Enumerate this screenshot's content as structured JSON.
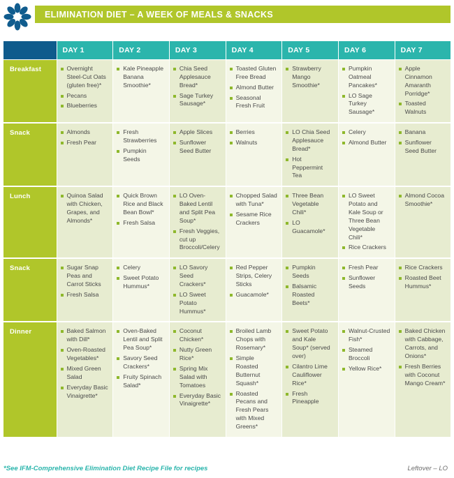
{
  "header": {
    "logo_icon": "flower-asterisk-logo",
    "title": "ELIMINATION DIET – A WEEK OF MEALS & SNACKS",
    "title_bar_color": "#b0c62a",
    "logo_color": "#105c8e"
  },
  "table": {
    "corner_label": "",
    "day_columns": [
      "DAY 1",
      "DAY 2",
      "DAY 3",
      "DAY 4",
      "DAY 5",
      "DAY 6",
      "DAY 7"
    ],
    "row_labels": [
      "Breakfast",
      "Snack",
      "Lunch",
      "Snack",
      "Dinner"
    ],
    "colors": {
      "header_corner": "#0f5b8c",
      "day_header": "#2bb5ac",
      "row_label": "#b0c62a",
      "cell_odd": "#e7ecd0",
      "cell_even": "#f4f6e7",
      "bullet": "#8eb82c",
      "cell_text": "#4a4a4a"
    },
    "rows": [
      {
        "label": "Breakfast",
        "cells": [
          [
            "Overnight Steel-Cut Oats (gluten free)*",
            "Pecans",
            "Blueberries"
          ],
          [
            "Kale Pineapple Banana Smoothie*"
          ],
          [
            "Chia Seed Applesauce Bread*",
            "Sage Turkey Sausage*"
          ],
          [
            "Toasted Gluten Free Bread",
            "Almond Butter",
            "Seasonal Fresh Fruit"
          ],
          [
            "Strawberry Mango Smoothie*"
          ],
          [
            "Pumpkin Oatmeal Pancakes*",
            "LO Sage Turkey Sausage*"
          ],
          [
            "Apple Cinnamon Amaranth Porridge*",
            "Toasted Walnuts"
          ]
        ]
      },
      {
        "label": "Snack",
        "cells": [
          [
            "Almonds",
            "Fresh Pear"
          ],
          [
            "Fresh Strawberries",
            "Pumpkin Seeds"
          ],
          [
            "Apple Slices",
            "Sunflower Seed Butter"
          ],
          [
            "Berries",
            "Walnuts"
          ],
          [
            "LO Chia Seed Applesauce Bread*",
            "Hot Peppermint Tea"
          ],
          [
            "Celery",
            "Almond Butter"
          ],
          [
            "Banana",
            "Sunflower Seed Butter"
          ]
        ]
      },
      {
        "label": "Lunch",
        "cells": [
          [
            "Quinoa Salad with Chicken, Grapes, and Almonds*"
          ],
          [
            "Quick Brown Rice and Black Bean Bowl*",
            "Fresh Salsa"
          ],
          [
            "LO Oven-Baked Lentil and Split Pea Soup*",
            "Fresh Veggies, cut up Broccoli/Celery"
          ],
          [
            "Chopped Salad with Tuna*",
            "Sesame Rice Crackers"
          ],
          [
            "Three Bean Vegetable Chili*",
            "LO Guacamole*"
          ],
          [
            "LO Sweet Potato and Kale Soup or Three Bean Vegetable Chili*",
            "Rice Crackers"
          ],
          [
            "Almond Cocoa Smoothie*"
          ]
        ]
      },
      {
        "label": "Snack",
        "cells": [
          [
            "Sugar Snap Peas and Carrot Sticks",
            "Fresh Salsa"
          ],
          [
            "Celery",
            "Sweet Potato Hummus*"
          ],
          [
            "LO Savory Seed Crackers*",
            "LO Sweet Potato Hummus*"
          ],
          [
            "Red Pepper Strips, Celery Sticks",
            "Guacamole*"
          ],
          [
            "Pumpkin Seeds",
            "Balsamic Roasted Beets*"
          ],
          [
            "Fresh Pear",
            "Sunflower Seeds"
          ],
          [
            "Rice Crackers",
            "Roasted Beet Hummus*"
          ]
        ]
      },
      {
        "label": "Dinner",
        "cells": [
          [
            "Baked Salmon with Dill*",
            "Oven-Roasted Vegetables*",
            "Mixed Green Salad",
            "Everyday Basic Vinaigrette*"
          ],
          [
            "Oven-Baked Lentil and Split Pea Soup*",
            "Savory Seed Crackers*",
            "Fruity Spinach Salad*"
          ],
          [
            "Coconut Chicken*",
            "Nutty Green Rice*",
            "Spring Mix Salad with Tomatoes",
            "Everyday Basic Vinaigrette*"
          ],
          [
            "Broiled Lamb Chops with Rosemary*",
            "Simple Roasted Butternut Squash*",
            "Roasted Pecans and Fresh Pears with Mixed Greens*"
          ],
          [
            "Sweet Potato and Kale Soup* (served over)",
            "Cilantro Lime Cauliflower Rice*",
            "Fresh Pineapple"
          ],
          [
            "Walnut-Crusted Fish*",
            "Steamed Broccoli",
            "Yellow Rice*"
          ],
          [
            "Baked Chicken with Cabbage, Carrots, and Onions*",
            "Fresh Berries with Coconut Mango Cream*"
          ]
        ]
      }
    ]
  },
  "footer": {
    "note": "*See IFM-Comprehensive Elimination Diet Recipe File for recipes",
    "legend": "Leftover – LO",
    "note_color": "#2bb5ac"
  }
}
